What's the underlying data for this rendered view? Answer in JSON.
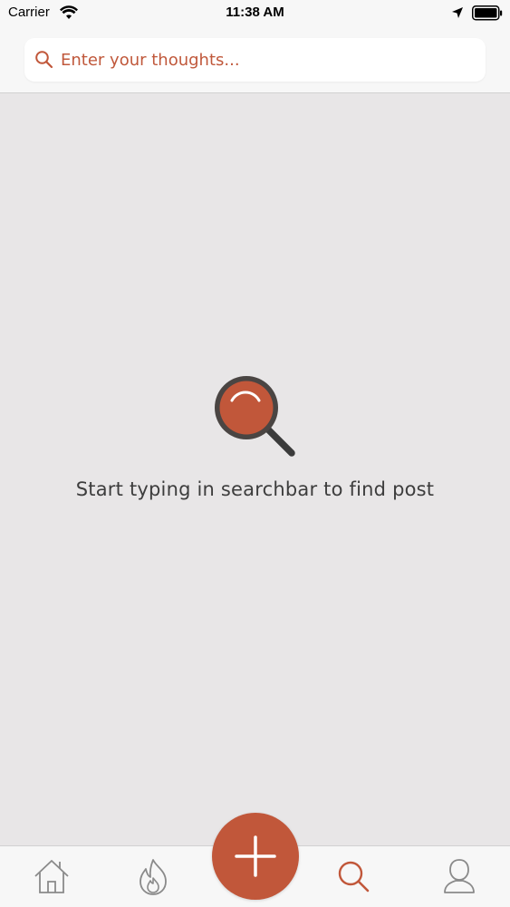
{
  "status_bar": {
    "carrier": "Carrier",
    "time": "11:38 AM"
  },
  "search": {
    "placeholder": "Enter your thoughts..."
  },
  "empty_state": {
    "message": "Start typing in searchbar to find post"
  },
  "tab_bar": {
    "items": [
      "home-icon",
      "flame-icon",
      "plus-icon",
      "search-icon",
      "profile-icon"
    ],
    "active": "search-icon"
  },
  "colors": {
    "accent": "#c1573a",
    "background": "#e8e6e7",
    "bar": "#f7f7f7",
    "icon_gray": "#8a8a8a"
  }
}
